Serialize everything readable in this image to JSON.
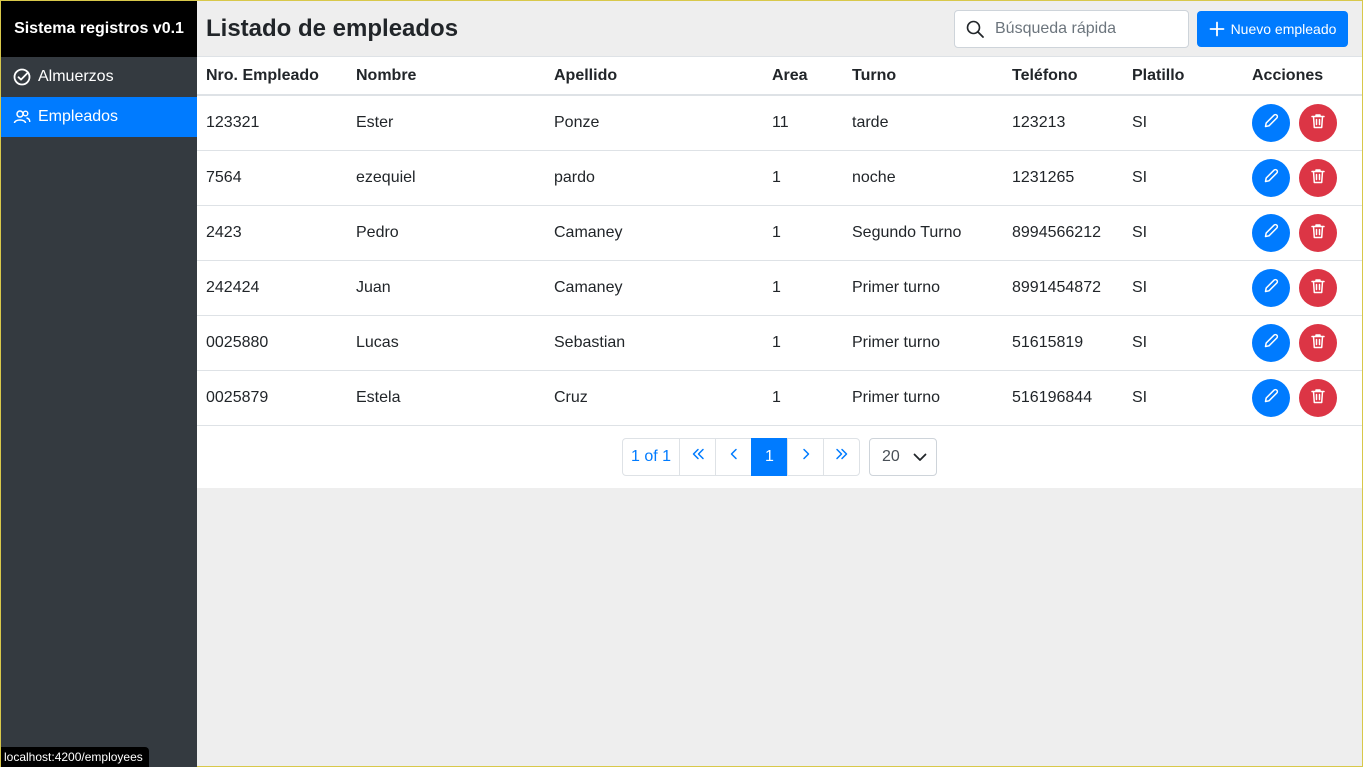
{
  "app": {
    "brand": "Sistema registros v0.1",
    "status_url": "localhost:4200/employees"
  },
  "sidebar": {
    "items": [
      {
        "label": "Almuerzos",
        "icon": "check-circle-icon",
        "active": false
      },
      {
        "label": "Empleados",
        "icon": "users-icon",
        "active": true
      }
    ]
  },
  "header": {
    "title": "Listado de empleados",
    "search_placeholder": "Búsqueda rápida",
    "new_button_label": "Nuevo empleado"
  },
  "table": {
    "columns": [
      "Nro. Empleado",
      "Nombre",
      "Apellido",
      "Area",
      "Turno",
      "Teléfono",
      "Platillo",
      "Acciones"
    ],
    "rows": [
      {
        "nro": "123321",
        "nombre": "Ester",
        "apellido": "Ponze",
        "area": "11",
        "turno": "tarde",
        "telefono": "123213",
        "platillo": "SI"
      },
      {
        "nro": "7564",
        "nombre": "ezequiel",
        "apellido": "pardo",
        "area": "1",
        "turno": "noche",
        "telefono": "1231265",
        "platillo": "SI"
      },
      {
        "nro": "2423",
        "nombre": "Pedro",
        "apellido": "Camaney",
        "area": "1",
        "turno": "Segundo Turno",
        "telefono": "8994566212",
        "platillo": "SI"
      },
      {
        "nro": "242424",
        "nombre": "Juan",
        "apellido": "Camaney",
        "area": "1",
        "turno": "Primer turno",
        "telefono": "8991454872",
        "platillo": "SI"
      },
      {
        "nro": "0025880",
        "nombre": "Lucas",
        "apellido": "Sebastian",
        "area": "1",
        "turno": "Primer turno",
        "telefono": "51615819",
        "platillo": "SI"
      },
      {
        "nro": "0025879",
        "nombre": "Estela",
        "apellido": "Cruz",
        "area": "1",
        "turno": "Primer turno",
        "telefono": "516196844",
        "platillo": "SI"
      }
    ]
  },
  "pagination": {
    "summary": "1 of 1",
    "first": "«",
    "prev": "‹",
    "current": "1",
    "next": "›",
    "last": "»",
    "page_size": "20"
  },
  "colors": {
    "primary": "#007bff",
    "danger": "#dc3545",
    "sidebar_bg": "#343a40"
  }
}
